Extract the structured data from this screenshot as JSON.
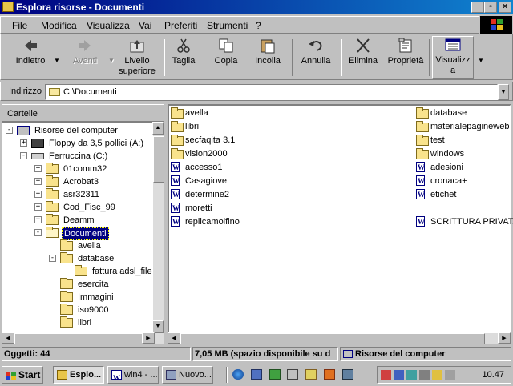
{
  "window": {
    "title": "Esplora risorse - Documenti"
  },
  "menu": [
    {
      "label": "File",
      "key": "F"
    },
    {
      "label": "Modifica",
      "key": "M"
    },
    {
      "label": "Visualizza",
      "key": "V"
    },
    {
      "label": "Vai",
      "key": "a"
    },
    {
      "label": "Preferiti",
      "key": "P"
    },
    {
      "label": "Strumenti",
      "key": "S"
    },
    {
      "label": "?",
      "key": "?"
    }
  ],
  "toolbar": {
    "back": "Indietro",
    "forward": "Avanti",
    "up_line1": "Livello",
    "up_line2": "superiore",
    "cut": "Taglia",
    "copy": "Copia",
    "paste": "Incolla",
    "undo": "Annulla",
    "delete": "Elimina",
    "properties": "Proprietà",
    "views_line1": "Visualizz",
    "views_line2": "a"
  },
  "address": {
    "label": "Indirizzo",
    "value": "C:\\Documenti"
  },
  "left_pane": {
    "header": "Cartelle",
    "tree": [
      {
        "label": "Risorse del computer",
        "icon": "computer-icon",
        "pm": "−"
      },
      {
        "label": "Floppy da 3,5 pollici (A:)",
        "icon": "floppy-icon",
        "pm": "+"
      },
      {
        "label": "Ferruccina (C:)",
        "icon": "harddisk-icon",
        "pm": "−"
      },
      {
        "label": "01comm32",
        "icon": "folder-icon",
        "pm": "+"
      },
      {
        "label": "Acrobat3",
        "icon": "folder-icon",
        "pm": "+"
      },
      {
        "label": "asr32311",
        "icon": "folder-icon",
        "pm": "+"
      },
      {
        "label": "Cod_Fisc_99",
        "icon": "folder-icon",
        "pm": "+"
      },
      {
        "label": "Deamm",
        "icon": "folder-icon",
        "pm": "+"
      },
      {
        "label": "Documenti",
        "icon": "open-folder-icon",
        "pm": "−"
      },
      {
        "label": "avella",
        "icon": "folder-icon",
        "pm": ""
      },
      {
        "label": "database",
        "icon": "folder-icon",
        "pm": "−"
      },
      {
        "label": "fattura adsl_file",
        "icon": "folder-icon",
        "pm": ""
      },
      {
        "label": "esercita",
        "icon": "folder-icon",
        "pm": ""
      },
      {
        "label": "Immagini",
        "icon": "folder-icon",
        "pm": ""
      },
      {
        "label": "iso9000",
        "icon": "folder-icon",
        "pm": ""
      },
      {
        "label": "libri",
        "icon": "folder-icon",
        "pm": ""
      }
    ]
  },
  "files": {
    "col1": [
      {
        "name": "avella",
        "type": "folder"
      },
      {
        "name": "libri",
        "type": "folder"
      },
      {
        "name": "secfaqita 3.1",
        "type": "folder"
      },
      {
        "name": "vision2000",
        "type": "folder"
      },
      {
        "name": "accesso1",
        "type": "doc"
      },
      {
        "name": "Casagiove",
        "type": "doc"
      },
      {
        "name": "determine2",
        "type": "doc"
      },
      {
        "name": "moretti",
        "type": "doc"
      },
      {
        "name": "replicamolfino",
        "type": "doc"
      }
    ],
    "col2": [
      {
        "name": "database",
        "type": "folder"
      },
      {
        "name": "materialepagineweb",
        "type": "folder"
      },
      {
        "name": "test",
        "type": "folder"
      },
      {
        "name": "windows",
        "type": "folder"
      },
      {
        "name": "adesioni",
        "type": "doc"
      },
      {
        "name": "cronaca+",
        "type": "doc"
      },
      {
        "name": "etichet",
        "type": "doc"
      },
      {
        "name": "",
        "type": "none"
      },
      {
        "name": "SCRITTURA PRIVATA",
        "type": "doc"
      }
    ]
  },
  "status": {
    "objects": "Oggetti: 44",
    "space": "7,05 MB (spazio disponibile su d",
    "location": "Risorse del computer"
  },
  "taskbar": {
    "start": "Start",
    "tasks": [
      "Esplo...",
      "win4 - ...",
      "Nuovo..."
    ],
    "clock": "10.47"
  },
  "colors": {
    "titlebar_start": "#000080",
    "titlebar_end": "#1084d0",
    "face": "#c0c0c0",
    "selection": "#000080"
  }
}
